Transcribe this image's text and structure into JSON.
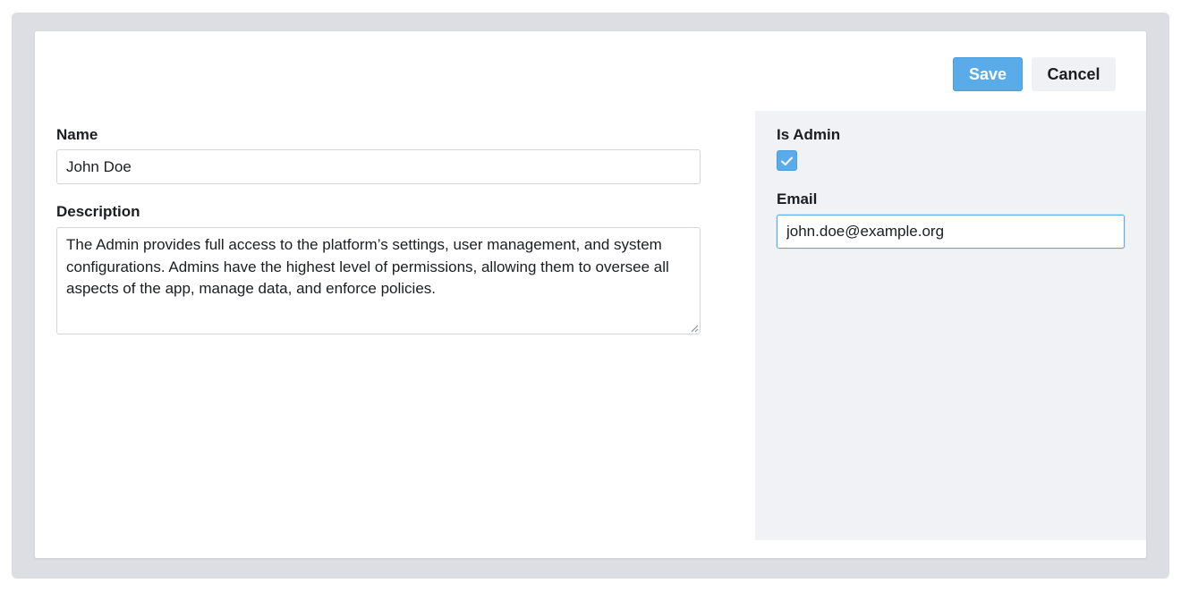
{
  "toolbar": {
    "save_label": "Save",
    "cancel_label": "Cancel"
  },
  "form": {
    "name": {
      "label": "Name",
      "value": "John Doe"
    },
    "description": {
      "label": "Description",
      "value": "The Admin provides full access to the platform’s settings, user management, and system configurations. Admins have the highest level of permissions, allowing them to oversee all aspects of the app, manage data, and enforce policies."
    }
  },
  "side": {
    "is_admin": {
      "label": "Is Admin",
      "checked": true
    },
    "email": {
      "label": "Email",
      "value": "john.doe@example.org"
    }
  },
  "icons": {
    "checkbox": "check-icon",
    "resize": "resize-grip-icon"
  },
  "colors": {
    "accent": "#5aabea",
    "panel": "#f0f2f6",
    "backdrop": "#dcdee3"
  }
}
